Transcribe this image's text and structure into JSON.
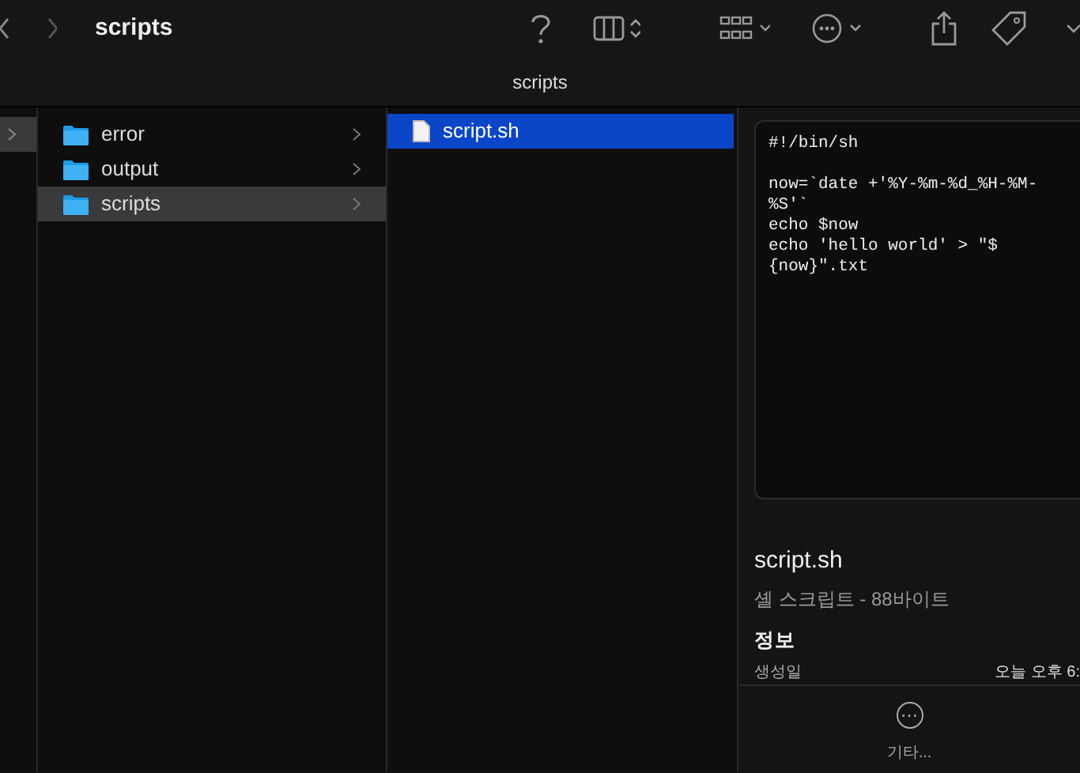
{
  "toolbar": {
    "title": "scripts"
  },
  "path_bar": {
    "title": "scripts"
  },
  "parent_column": {
    "items": [
      {
        "selected": true
      }
    ]
  },
  "folders": [
    {
      "name": "error",
      "selected": false
    },
    {
      "name": "output",
      "selected": false
    },
    {
      "name": "scripts",
      "selected": true
    }
  ],
  "files": [
    {
      "name": "script.sh",
      "selected": true
    }
  ],
  "preview": {
    "code": "#!/bin/sh\n\nnow=`date +'%Y-%m-%d_%H-%M-\n%S'`\necho $now\necho 'hello world' > \"$\n{now}\".txt",
    "file_name": "script.sh",
    "file_info": "셸 스크립트 - 88바이트",
    "section_title": "정보",
    "info_rows": [
      {
        "label": "생성일",
        "value": "오늘 오후 6:"
      }
    ]
  },
  "more_button": {
    "icon": "⋯",
    "label": "기타..."
  }
}
